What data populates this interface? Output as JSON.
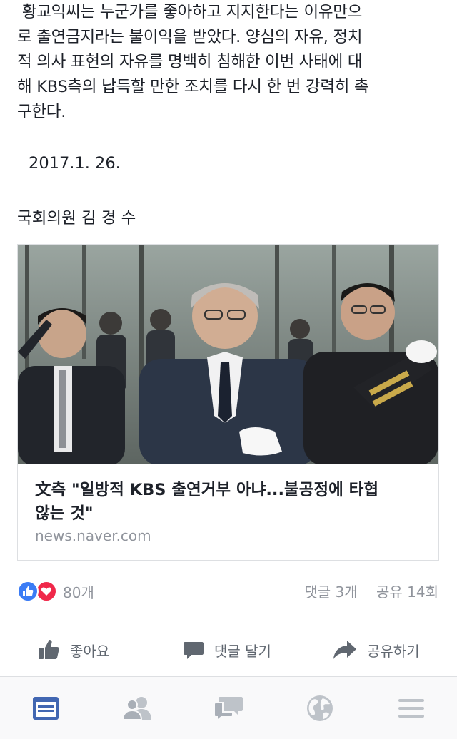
{
  "post": {
    "paragraph_lines": [
      " 황교익씨는 누군가를 좋아하고 지지한다는 이유만으",
      "로 출연금지라는 불이익을 받았다. 양심의 자유, 정치",
      "적 의사 표현의 자유를 명백히 침해한 이번 사태에 대",
      "해 KBS측의 납득할 만한 조치를 다시 한 번 강력히 촉",
      "구한다."
    ],
    "date": "2017.1. 26.",
    "signature": "국회의원 김 경 수"
  },
  "link": {
    "title_lines": [
      "文측 \"일방적 KBS 출연거부 아냐...불공정에 타협",
      "않는 것\""
    ],
    "domain": "news.naver.com"
  },
  "reactions": {
    "count": "80개",
    "comments": "댓글 3개",
    "shares": "공유 14회"
  },
  "actions": {
    "like": "좋아요",
    "comment": "댓글 달기",
    "share": "공유하기"
  },
  "tabs": [
    {
      "name": "news-feed",
      "icon": "news-feed-icon",
      "active": true
    },
    {
      "name": "friends",
      "icon": "friends-icon",
      "active": false
    },
    {
      "name": "messages",
      "icon": "messages-icon",
      "active": false
    },
    {
      "name": "notifications",
      "icon": "globe-icon",
      "active": false
    },
    {
      "name": "menu",
      "icon": "menu-icon",
      "active": false
    }
  ],
  "colors": {
    "accent": "#4267b2",
    "like": "#3b7cf5",
    "love": "#f0284a",
    "muted": "#90949c"
  }
}
